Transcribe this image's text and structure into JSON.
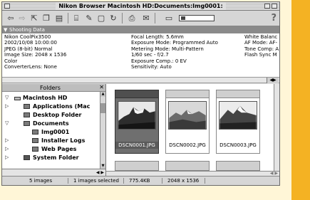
{
  "window": {
    "title": "Nikon Browser Macintosh HD:Documents:Img0001:"
  },
  "toolbar": {
    "icons": [
      "nav-back-icon",
      "nav-forward-icon",
      "move-icon",
      "copy-icon",
      "new-folder-icon",
      "folder-icon",
      "pen-icon",
      "rotate-icon",
      "print-icon",
      "mail-icon",
      "size-slider",
      "help-icon"
    ],
    "help_label": "?"
  },
  "shooting_data": {
    "header": "Shooting Data",
    "col1": [
      "Nikon CoolPix3500",
      "2002/10/08 10:00:00",
      "JPEG (8-bit) Normal",
      "Image Size: 2048 x 1536",
      "Color",
      "ConverterLens: None"
    ],
    "col2": [
      "Focal Length: 5.6mm",
      "Exposure Mode: Programmed Auto",
      "Metering Mode: Multi-Pattern",
      "1/60 sec - f/2.7",
      "Exposure Comp.: 0 EV",
      "Sensitivity: Auto"
    ],
    "col3": [
      "White Balanc",
      "AF Mode: AF-",
      "Tone Comp: A",
      "Flash Sync M"
    ]
  },
  "folders": {
    "header": "Folders",
    "items": [
      {
        "label": "Macintosh HD",
        "icon": "hard-disk-icon",
        "disclosure": "expanded"
      },
      {
        "label": "Applications (Mac",
        "icon": "folder-icon",
        "disclosure": "collapsed"
      },
      {
        "label": "Desktop Folder",
        "icon": "folder-icon",
        "disclosure": "none"
      },
      {
        "label": "Documents",
        "icon": "folder-icon",
        "disclosure": "expanded"
      },
      {
        "label": "Img0001",
        "icon": "folder-icon",
        "disclosure": "none"
      },
      {
        "label": "Installer Logs",
        "icon": "folder-icon",
        "disclosure": "collapsed"
      },
      {
        "label": "Web Pages",
        "icon": "folder-icon",
        "disclosure": "collapsed"
      },
      {
        "label": "System Folder",
        "icon": "system-folder-icon",
        "disclosure": "collapsed"
      }
    ]
  },
  "thumbnails": [
    {
      "name": "DSCN0001.JPG",
      "selected": true
    },
    {
      "name": "DSCN0002.JPG",
      "selected": false
    },
    {
      "name": "DSCN0003.JPG",
      "selected": false
    }
  ],
  "status": {
    "count": "5 images",
    "selection": "1 images selected",
    "filesize": "775.4KB",
    "dimensions": "2048 x 1536"
  },
  "colors": {
    "page_bg": "#fff6d7",
    "accent": "#f4b223",
    "selection": "#6f6f6f"
  }
}
